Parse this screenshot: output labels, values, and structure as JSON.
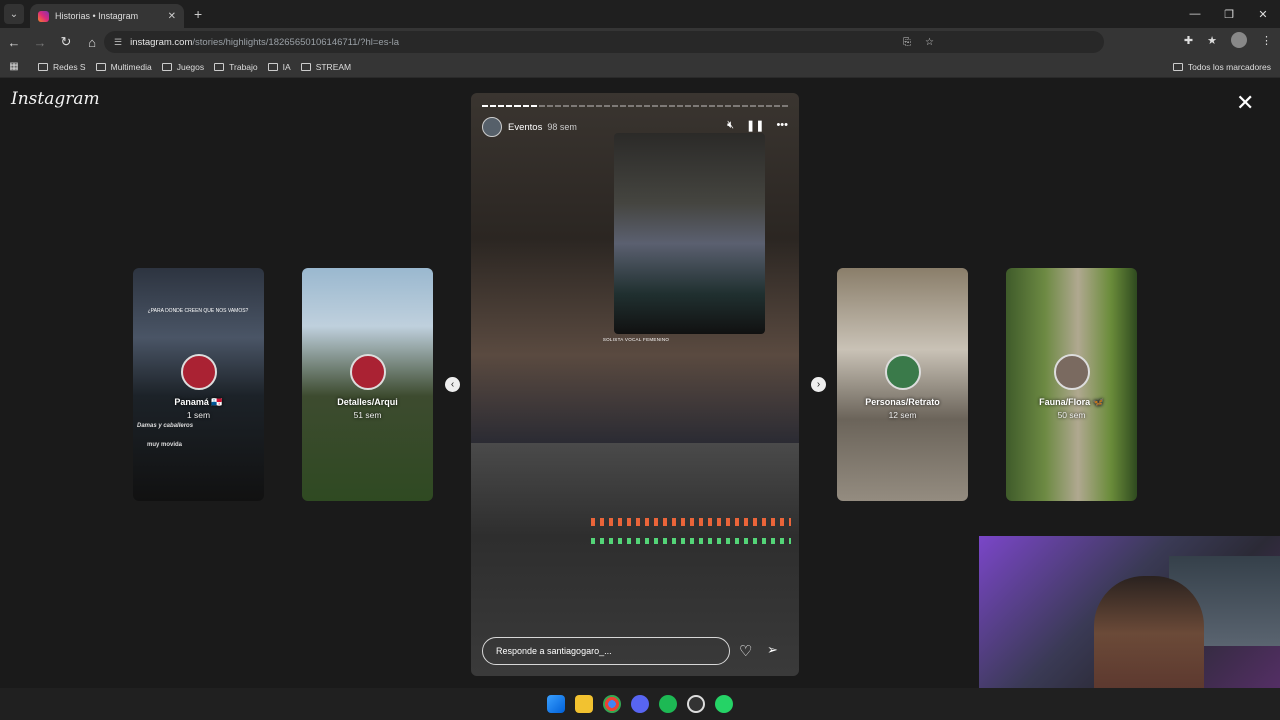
{
  "browser": {
    "tab_title": "Historias • Instagram",
    "url_host": "instagram.com",
    "url_path": "/stories/highlights/18265650106146711/?hl=es-la",
    "bookmarks": [
      "Redes S",
      "Multimedia",
      "Juegos",
      "Trabajo",
      "IA",
      "STREAM"
    ],
    "bookmarks_right": "Todos los marcadores"
  },
  "page": {
    "logo": "Instagram",
    "close_label": "✕"
  },
  "story": {
    "account": "Eventos",
    "time": "98 sem",
    "progress_done_segments": 7,
    "progress_total_segments": 38,
    "banner_text": "SOLISTA VOCAL FEMENINO",
    "reply_placeholder": "Responde a santiagogaro_..."
  },
  "highlights": [
    {
      "name": "Panamá 🇵🇦",
      "time": "1 sem"
    },
    {
      "name": "Detalles/Arqui",
      "time": "51 sem"
    },
    {
      "name": "Personas/Retrato",
      "time": "12 sem"
    },
    {
      "name": "Fauna/Flora 🦋",
      "time": "50 sem"
    }
  ],
  "card1_text": {
    "q": "¿PARA DONDE CREEN QUE NOS VAMOS?",
    "line1": "Damas y caballeros",
    "line2": "muy movida"
  },
  "accent": {
    "ig_gradient": [
      "#f58529",
      "#dd2a7b",
      "#8134af"
    ]
  }
}
